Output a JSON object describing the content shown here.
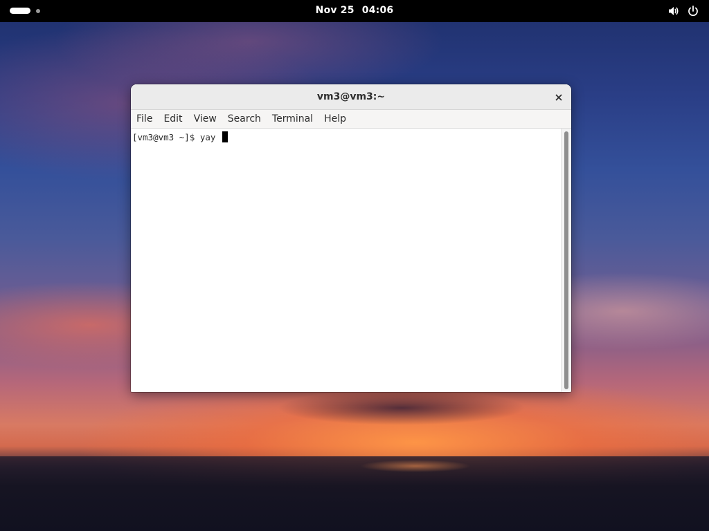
{
  "topbar": {
    "date": "Nov 25",
    "time": "04:06",
    "icons": [
      "activities-indicator",
      "volume-icon",
      "power-icon"
    ]
  },
  "window": {
    "title": "vm3@vm3:~",
    "close_icon": "close-icon",
    "menu": [
      "File",
      "Edit",
      "View",
      "Search",
      "Terminal",
      "Help"
    ]
  },
  "terminal": {
    "prompt": "[vm3@vm3 ~]$ ",
    "command": "yay "
  },
  "colors": {
    "topbar_bg": "#000000",
    "titlebar_bg": "#ebebeb",
    "terminal_bg": "#ffffff",
    "terminal_fg": "#2b2b2b"
  }
}
